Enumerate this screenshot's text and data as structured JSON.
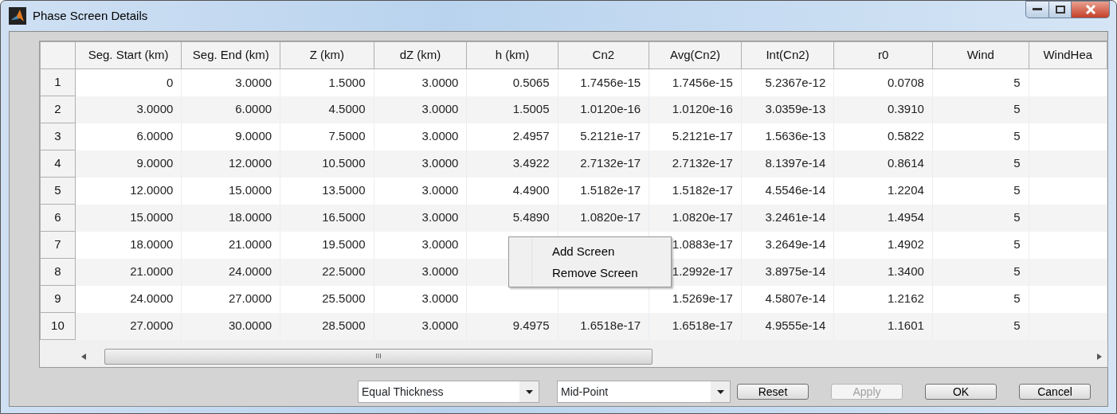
{
  "window": {
    "title": "Phase Screen Details"
  },
  "table": {
    "columns": [
      "Seg. Start (km)",
      "Seg. End (km)",
      "Z (km)",
      "dZ (km)",
      "h (km)",
      "Cn2",
      "Avg(Cn2)",
      "Int(Cn2)",
      "r0",
      "Wind",
      "WindHea"
    ],
    "rows": [
      {
        "label": "1",
        "cells": [
          "0",
          "3.0000",
          "1.5000",
          "3.0000",
          "0.5065",
          "1.7456e-15",
          "1.7456e-15",
          "5.2367e-12",
          "0.0708",
          "5",
          null
        ]
      },
      {
        "label": "2",
        "cells": [
          "3.0000",
          "6.0000",
          "4.5000",
          "3.0000",
          "1.5005",
          "1.0120e-16",
          "1.0120e-16",
          "3.0359e-13",
          "0.3910",
          "5",
          null
        ]
      },
      {
        "label": "3",
        "cells": [
          "6.0000",
          "9.0000",
          "7.5000",
          "3.0000",
          "2.4957",
          "5.2121e-17",
          "5.2121e-17",
          "1.5636e-13",
          "0.5822",
          "5",
          null
        ]
      },
      {
        "label": "4",
        "cells": [
          "9.0000",
          "12.0000",
          "10.5000",
          "3.0000",
          "3.4922",
          "2.7132e-17",
          "2.7132e-17",
          "8.1397e-14",
          "0.8614",
          "5",
          null
        ]
      },
      {
        "label": "5",
        "cells": [
          "12.0000",
          "15.0000",
          "13.5000",
          "3.0000",
          "4.4900",
          "1.5182e-17",
          "1.5182e-17",
          "4.5546e-14",
          "1.2204",
          "5",
          null
        ]
      },
      {
        "label": "6",
        "cells": [
          "15.0000",
          "18.0000",
          "16.5000",
          "3.0000",
          "5.4890",
          "1.0820e-17",
          "1.0820e-17",
          "3.2461e-14",
          "1.4954",
          "5",
          null
        ]
      },
      {
        "label": "7",
        "cells": [
          "18.0000",
          "21.0000",
          "19.5000",
          "3.0000",
          null,
          null,
          "1.0883e-17",
          "3.2649e-14",
          "1.4902",
          "5",
          null
        ]
      },
      {
        "label": "8",
        "cells": [
          "21.0000",
          "24.0000",
          "22.5000",
          "3.0000",
          null,
          null,
          "1.2992e-17",
          "3.8975e-14",
          "1.3400",
          "5",
          null
        ]
      },
      {
        "label": "9",
        "cells": [
          "24.0000",
          "27.0000",
          "25.5000",
          "3.0000",
          null,
          null,
          "1.5269e-17",
          "4.5807e-14",
          "1.2162",
          "5",
          null
        ]
      },
      {
        "label": "10",
        "cells": [
          "27.0000",
          "30.0000",
          "28.5000",
          "3.0000",
          "9.4975",
          "1.6518e-17",
          "1.6518e-17",
          "4.9555e-14",
          "1.1601",
          "5",
          null
        ]
      }
    ],
    "scrollbar_grip": "III"
  },
  "context_menu": {
    "items": [
      "Add Screen",
      "Remove Screen"
    ]
  },
  "dropdowns": [
    {
      "value": "Equal Thickness"
    },
    {
      "value": "Mid-Point"
    }
  ],
  "buttons": [
    {
      "label": "Reset",
      "disabled": false
    },
    {
      "label": "Apply",
      "disabled": true
    },
    {
      "label": "OK",
      "disabled": false
    },
    {
      "label": "Cancel",
      "disabled": false
    }
  ]
}
